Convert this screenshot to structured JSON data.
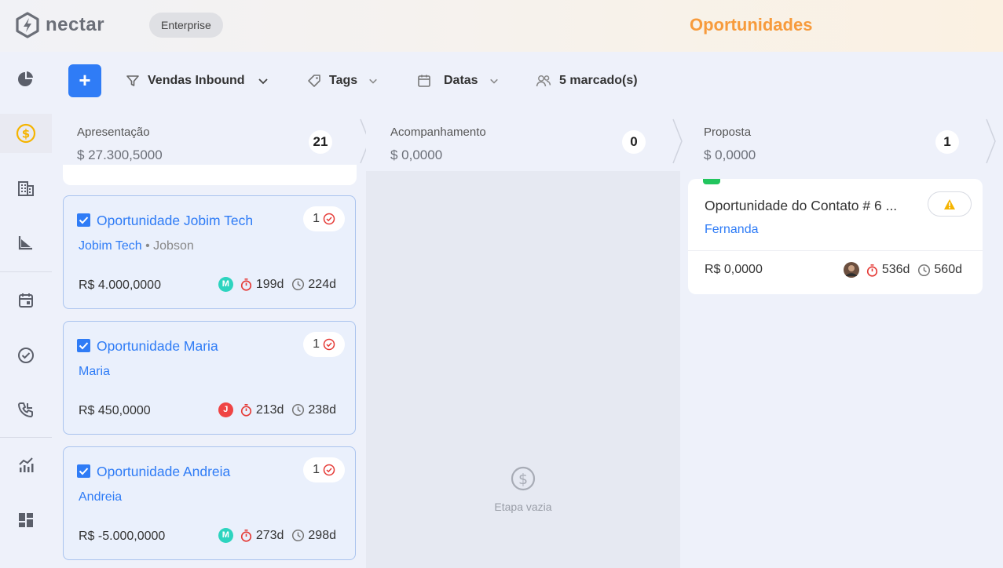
{
  "app": {
    "logo": "nectar",
    "plan": "Enterprise",
    "page_title": "Oportunidades"
  },
  "sidebar": {
    "items": [
      {
        "icon": "pie-chart-icon",
        "label": "Dashboard"
      },
      {
        "icon": "dollar-circle-icon",
        "label": "Oportunidades",
        "active": true
      },
      {
        "icon": "building-icon",
        "label": "Empresas"
      },
      {
        "icon": "funnel-chart-icon",
        "label": "Funil"
      },
      {
        "icon": "calendar-icon",
        "label": "Agenda"
      },
      {
        "icon": "check-circle-icon",
        "label": "Tarefas"
      },
      {
        "icon": "phone-icon",
        "label": "Ligações"
      },
      {
        "icon": "analytics-icon",
        "label": "Relatórios"
      },
      {
        "icon": "apps-icon",
        "label": "Apps"
      }
    ]
  },
  "toolbar": {
    "add_label": "+",
    "pipeline": "Vendas Inbound",
    "tags": "Tags",
    "dates": "Datas",
    "selected": "5 marcado(s)"
  },
  "columns": [
    {
      "name": "Apresentação",
      "total": "$ 27.300,5000",
      "count": "21"
    },
    {
      "name": "Acompanhamento",
      "total": "$ 0,0000",
      "count": "0",
      "empty_text": "Etapa vazia"
    },
    {
      "name": "Proposta",
      "total": "$ 0,0000",
      "count": "1"
    }
  ],
  "cards": [
    {
      "title": "Oportunidade Jobim Tech",
      "company": "Jobim Tech",
      "contact": "Jobson",
      "amount": "R$ 4.000,0000",
      "tasks": "1",
      "owner_initial": "M",
      "owner_color": "#2dd4bf",
      "timer": "199d",
      "age": "224d"
    },
    {
      "title": "Oportunidade Maria",
      "company": "Maria",
      "contact": "",
      "amount": "R$ 450,0000",
      "tasks": "1",
      "owner_initial": "J",
      "owner_color": "#ef4444",
      "timer": "213d",
      "age": "238d"
    },
    {
      "title": "Oportunidade Andreia",
      "company": "Andreia",
      "contact": "",
      "amount": "R$ -5.000,0000",
      "tasks": "1",
      "owner_initial": "M",
      "owner_color": "#2dd4bf",
      "timer": "273d",
      "age": "298d"
    }
  ],
  "proposal_card": {
    "title": "Oportunidade do Contato # 6 ...",
    "contact": "Fernanda",
    "amount": "R$ 0,0000",
    "timer": "536d",
    "age": "560d"
  },
  "colors": {
    "accent": "#2f7cf6",
    "title": "#f79b3c",
    "warning": "#f5b400",
    "timer": "#e53935"
  }
}
